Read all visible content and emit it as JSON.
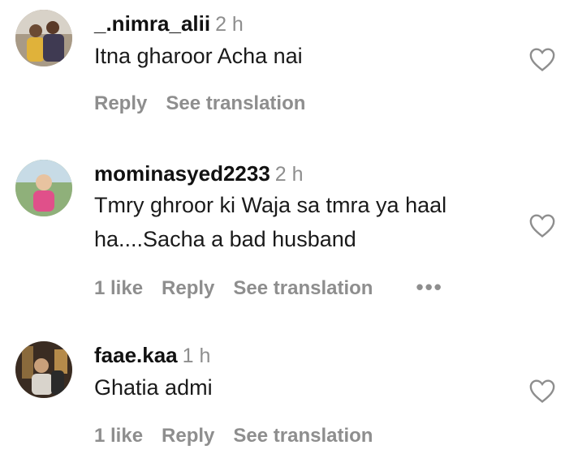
{
  "comments": [
    {
      "username": "_.nimra_alii",
      "time": "2 h",
      "text": "Itna gharoor Acha nai",
      "likes": "",
      "reply": "Reply",
      "see_translation": "See translation",
      "icon": "heart-outline-icon"
    },
    {
      "username": "mominasyed2233",
      "time": "2 h",
      "text_line1": "Tmry ghroor ki Waja sa tmra ya haal",
      "text_line2": "ha....Sacha a bad husband",
      "likes": "1 like",
      "reply": "Reply",
      "see_translation": "See translation",
      "more": "•••",
      "icon": "heart-outline-icon"
    },
    {
      "username": "faae.kaa",
      "time": "1 h",
      "text": "Ghatia admi",
      "likes": "1 like",
      "reply": "Reply",
      "see_translation": "See translation",
      "icon": "heart-outline-icon"
    }
  ]
}
